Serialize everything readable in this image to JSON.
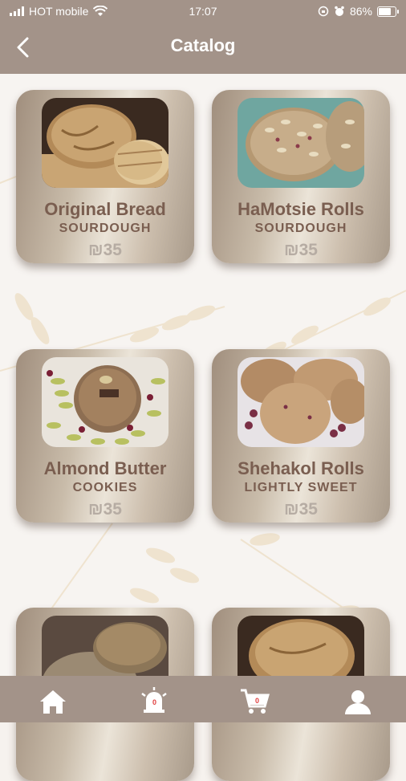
{
  "status_bar": {
    "carrier": "HOT mobile",
    "time": "17:07",
    "battery": "86%",
    "battery_level": 0.86
  },
  "header": {
    "title": "Catalog"
  },
  "products": [
    {
      "name": "Original Bread",
      "category": "SOURDOUGH",
      "price": "₪35"
    },
    {
      "name": "HaMotsie Rolls",
      "category": "SOURDOUGH",
      "price": "₪35"
    },
    {
      "name": "Almond Butter",
      "category": "COOKIES",
      "price": "₪35"
    },
    {
      "name": "Shehakol Rolls",
      "category": "LIGHTLY SWEET",
      "price": "₪35"
    }
  ],
  "bottom_nav": {
    "items": [
      "home-icon",
      "bell-icon",
      "cart-icon",
      "profile-icon"
    ],
    "notifications_count": "0",
    "cart_count": "0"
  },
  "colors": {
    "header": "#a39389",
    "text": "#7a5e50",
    "price": "#b6aca3"
  }
}
